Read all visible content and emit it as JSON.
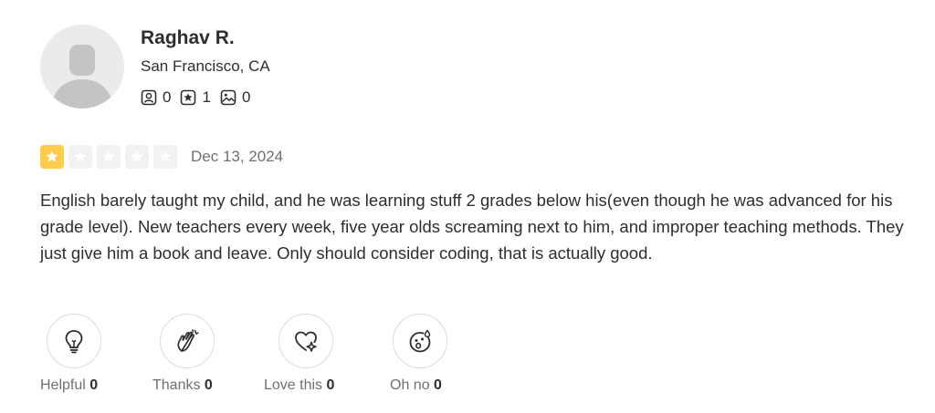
{
  "user": {
    "name": "Raghav R.",
    "location": "San Francisco, CA",
    "stats": {
      "friends": "0",
      "reviews": "1",
      "photos": "0"
    }
  },
  "review": {
    "rating": 1,
    "rating_max": 5,
    "date": "Dec 13, 2024",
    "text": "English barely taught my child, and he was learning stuff 2 grades below his(even though he was advanced for his grade level). New teachers every week, five year olds screaming next to him, and improper teaching methods. They just give him a book and leave. Only should consider coding, that is actually good."
  },
  "reactions": [
    {
      "label": "Helpful",
      "count": "0",
      "icon": "lightbulb-icon"
    },
    {
      "label": "Thanks",
      "count": "0",
      "icon": "clapping-hands-icon"
    },
    {
      "label": "Love this",
      "count": "0",
      "icon": "heart-sparkle-icon"
    },
    {
      "label": "Oh no",
      "count": "0",
      "icon": "surprised-face-icon"
    }
  ],
  "colors": {
    "star_filled": "#ffcc4b",
    "star_empty": "#f2f2f2",
    "text": "#2d2e2f",
    "muted": "#6e7072"
  }
}
